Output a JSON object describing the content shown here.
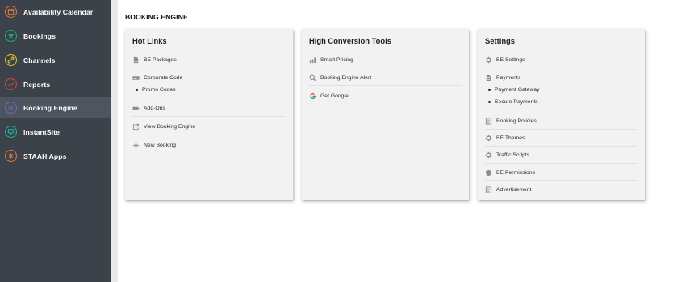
{
  "sidebar": {
    "items": [
      {
        "label": "Availability Calendar",
        "icon": "calendar-icon",
        "color": "#e0763a",
        "active": false
      },
      {
        "label": "Bookings",
        "icon": "bookings-icon",
        "color": "#22b37a",
        "active": false
      },
      {
        "label": "Channels",
        "icon": "link-icon",
        "color": "#e6c62e",
        "active": false
      },
      {
        "label": "Reports",
        "icon": "reports-icon",
        "color": "#d8453b",
        "active": false
      },
      {
        "label": "Booking Engine",
        "icon": "be-icon",
        "color": "#7a68c9",
        "active": true
      },
      {
        "label": "InstantSite",
        "icon": "monitor-icon",
        "color": "#21b5a6",
        "active": false
      },
      {
        "label": "STAAH Apps",
        "icon": "apps-icon",
        "color": "#e97a3a",
        "active": false
      }
    ]
  },
  "page": {
    "title": "BOOKING ENGINE"
  },
  "cards": {
    "hot_links": {
      "title": "Hot Links",
      "items": [
        {
          "label": "BE Packages",
          "icon": "document-icon"
        },
        {
          "label": "Corporate Code",
          "icon": "id-card-icon",
          "sub": [
            "Promo Codes"
          ]
        },
        {
          "label": "Add-Ons",
          "icon": "add-ons-icon"
        },
        {
          "label": "View Booking Engine",
          "icon": "external-link-icon"
        },
        {
          "label": "New Booking",
          "icon": "plus-icon"
        }
      ]
    },
    "conversion": {
      "title": "High Conversion Tools",
      "items": [
        {
          "label": "Smart Pricing",
          "icon": "pricing-icon"
        },
        {
          "label": "Booking Engine Alert",
          "icon": "magnifier-icon"
        },
        {
          "label": "Get Google",
          "icon": "google-icon"
        }
      ]
    },
    "settings": {
      "title": "Settings",
      "items": [
        {
          "label": "BE Settings",
          "icon": "gear-icon"
        },
        {
          "label": "Payments",
          "icon": "document-icon",
          "sub": [
            "Payment Gateway",
            "Secure Payments"
          ]
        },
        {
          "label": "Booking Policies",
          "icon": "policy-icon"
        },
        {
          "label": "BE Themes",
          "icon": "gear-icon"
        },
        {
          "label": "Traffic Scripts",
          "icon": "gear-icon"
        },
        {
          "label": "BE Permissions",
          "icon": "shield-icon"
        },
        {
          "label": "Advertisement",
          "icon": "policy-icon"
        }
      ]
    }
  }
}
